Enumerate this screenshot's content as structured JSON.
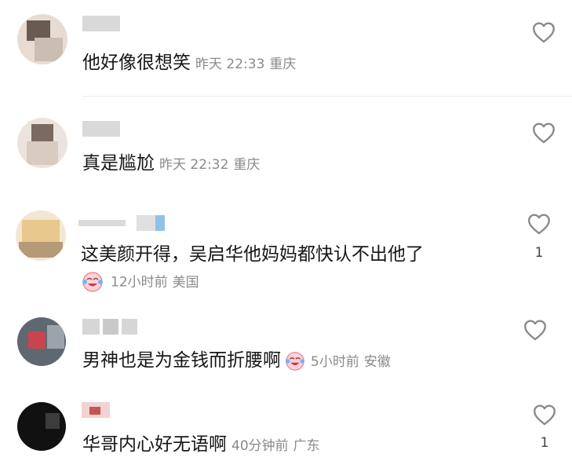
{
  "comments": [
    {
      "text": "他好像很想笑",
      "time": "昨天 22:33",
      "location": "重庆",
      "likes": ""
    },
    {
      "text": "真是尴尬",
      "time": "昨天 22:32",
      "location": "重庆",
      "likes": ""
    },
    {
      "text": "这美颜开得，吴启华他妈妈都快认不出他了",
      "time": "12小时前",
      "location": "美国",
      "likes": "1",
      "emoji": "crying-laughing-emoji"
    },
    {
      "text": "男神也是为金钱而折腰啊",
      "time": "5小时前",
      "location": "安徽",
      "likes": "",
      "emoji": "crying-laughing-emoji"
    },
    {
      "text": "华哥内心好无语啊",
      "time": "40分钟前",
      "location": "广东",
      "likes": "1"
    }
  ],
  "icons": {
    "like": "heart-outline-icon"
  },
  "colors": {
    "meta": "#8a8a8a",
    "text": "#161616",
    "divider": "#ececec"
  }
}
